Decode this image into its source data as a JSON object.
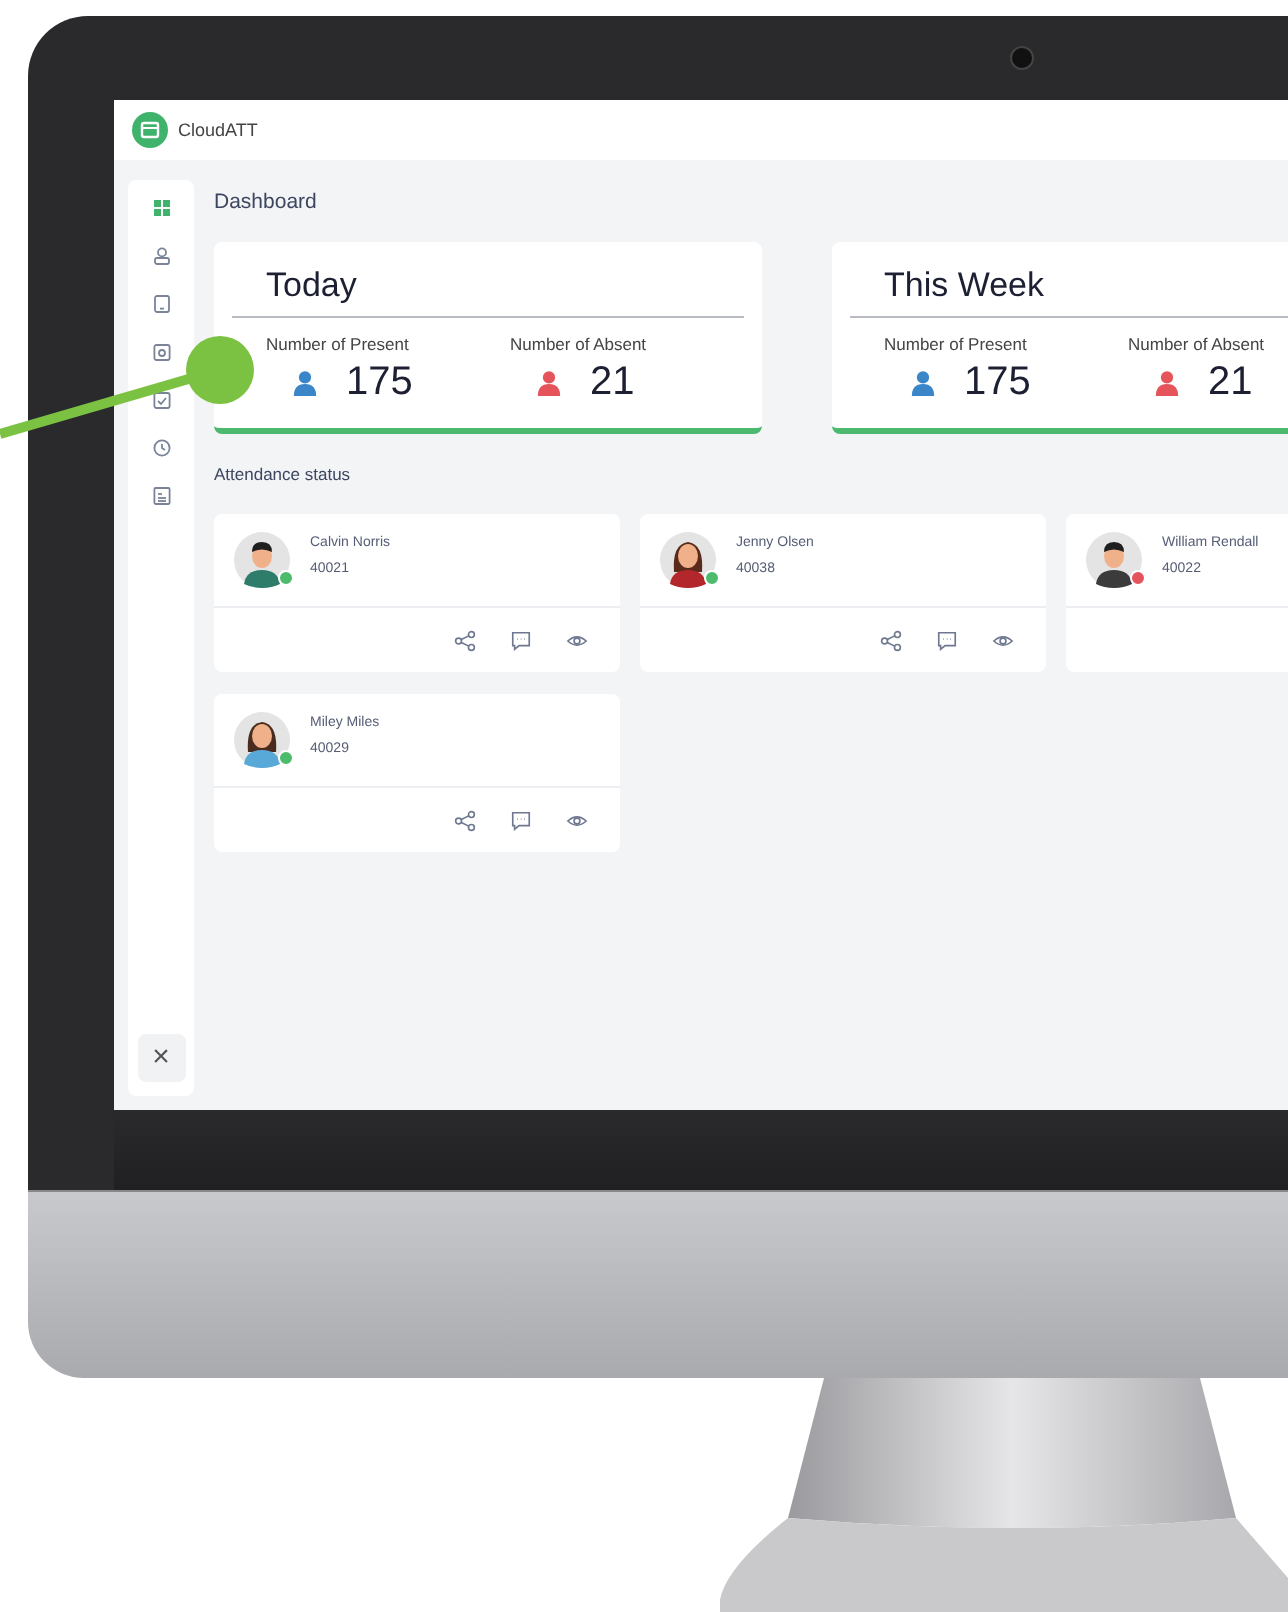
{
  "app": {
    "name": "CloudATT"
  },
  "sidebar": {
    "items": [
      {
        "selected": true
      },
      {
        "selected": false
      },
      {
        "selected": false
      },
      {
        "selected": false
      },
      {
        "selected": false
      },
      {
        "selected": false
      },
      {
        "selected": false
      }
    ],
    "close": "×"
  },
  "page_title": "Dashboard",
  "summary_cards": [
    {
      "title": "Today",
      "present_label": "Number of Present",
      "present_count": "175",
      "absent_label": "Number of Absent",
      "absent_count": "21"
    },
    {
      "title": "This Week",
      "present_label": "Number of Present",
      "present_count": "175",
      "absent_label": "Number of Absent",
      "absent_count": "21"
    }
  ],
  "section_title": "Attendance status",
  "people": [
    {
      "name": "Calvin Norris",
      "id": "40021",
      "color": "#4cbb6c"
    },
    {
      "name": "Jenny Olsen",
      "id": "40038",
      "color": "#4cbb6c"
    },
    {
      "name": "William Rendall",
      "id": "40022",
      "color": "#e5545b"
    },
    {
      "name": "Miley Miles",
      "id": "40029",
      "color": "#4cbb6c"
    }
  ]
}
